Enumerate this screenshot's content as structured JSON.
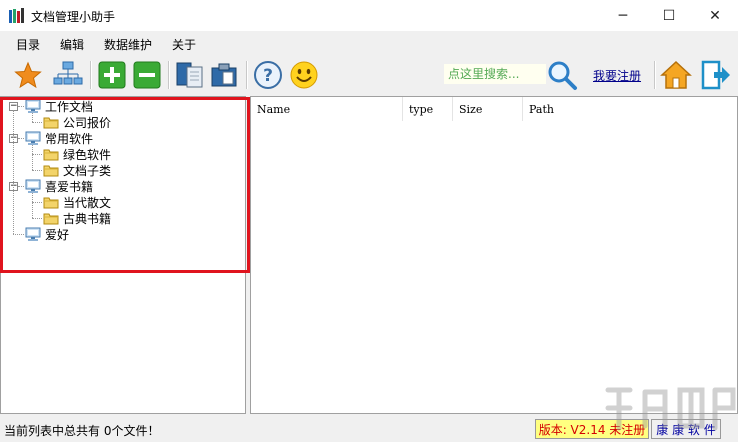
{
  "window": {
    "title": "文档管理小助手",
    "minimize_glyph": "─",
    "maximize_glyph": "☐",
    "close_glyph": "✕"
  },
  "menu": {
    "items": [
      {
        "label": "目录"
      },
      {
        "label": "编辑"
      },
      {
        "label": "数据维护"
      },
      {
        "label": "关于"
      }
    ]
  },
  "toolbar": {
    "icons": [
      "star-icon",
      "network-icon",
      "add-icon",
      "remove-icon",
      "copy-icon",
      "paste-icon",
      "help-icon",
      "smiley-icon",
      "search-icon",
      "home-icon",
      "exit-icon"
    ],
    "search_placeholder": "点这里搜索...",
    "register_label": "我要注册"
  },
  "tree": {
    "nodes": [
      {
        "label": "工作文档",
        "type": "computer",
        "level": 0,
        "expanded": true
      },
      {
        "label": "公司报价",
        "type": "folder",
        "level": 1
      },
      {
        "label": "常用软件",
        "type": "computer",
        "level": 0,
        "expanded": true
      },
      {
        "label": "绿色软件",
        "type": "folder",
        "level": 1
      },
      {
        "label": "文档子类",
        "type": "folder",
        "level": 1
      },
      {
        "label": "喜爱书籍",
        "type": "computer",
        "level": 0,
        "expanded": true
      },
      {
        "label": "当代散文",
        "type": "folder",
        "level": 1
      },
      {
        "label": "古典书籍",
        "type": "folder",
        "level": 1
      },
      {
        "label": "爱好",
        "type": "computer",
        "level": 0
      }
    ]
  },
  "list": {
    "columns": [
      "Name",
      "type",
      "Size",
      "Path"
    ],
    "rows": []
  },
  "status": {
    "message": "当前列表中总共有  0个文件！",
    "version": "版本: V2.14 未注册",
    "company": "康 康 软 件"
  },
  "colors": {
    "highlight": "#e0141e",
    "version_text": "#d40000",
    "version_bg": "#ffff80",
    "company_text": "#0000a0"
  }
}
